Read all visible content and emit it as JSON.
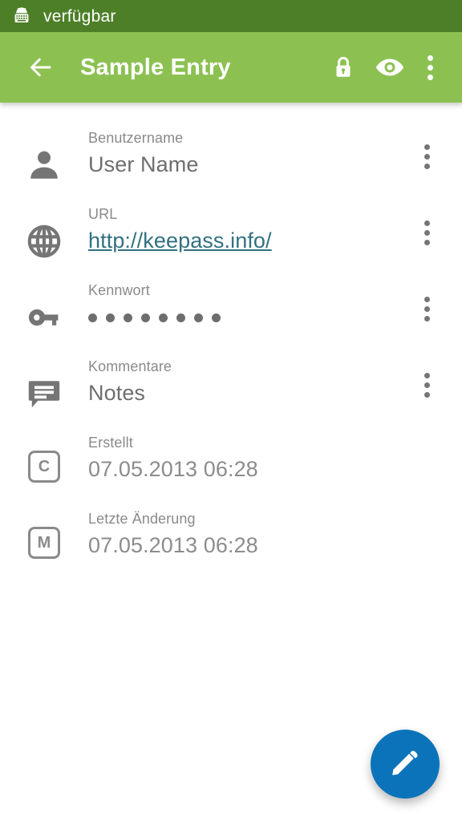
{
  "status_bar": {
    "icon": "android-keyboard-icon",
    "text": "verfügbar",
    "background": "#4c7f27",
    "text_color": "#ffffff"
  },
  "toolbar": {
    "back_icon": "arrow-back-icon",
    "title": "Sample Entry",
    "background": "#8cc152",
    "actions": [
      {
        "icon": "lock-icon",
        "name": "lock-database-button"
      },
      {
        "icon": "eye-icon",
        "name": "toggle-password-visibility-button"
      }
    ],
    "overflow_icon": "overflow-menu-icon"
  },
  "fields": [
    {
      "icon": "person-icon",
      "label": "Benutzername",
      "value": "User Name",
      "value_type": "text",
      "has_overflow": true
    },
    {
      "icon": "globe-icon",
      "label": "URL",
      "value": "http://keepass.info/",
      "value_type": "link",
      "has_overflow": true
    },
    {
      "icon": "key-icon",
      "label": "Kennwort",
      "value": "••••••••",
      "value_type": "masked",
      "dot_count": 8,
      "has_overflow": true
    },
    {
      "icon": "comment-icon",
      "label": "Kommentare",
      "value": "Notes",
      "value_type": "text",
      "has_overflow": true
    },
    {
      "icon": "created-badge-icon",
      "badge_letter": "C",
      "label": "Erstellt",
      "value": "07.05.2013 06:28",
      "value_type": "dim",
      "has_overflow": false
    },
    {
      "icon": "modified-badge-icon",
      "badge_letter": "M",
      "label": "Letzte Änderung",
      "value": "07.05.2013 06:28",
      "value_type": "dim",
      "has_overflow": false
    }
  ],
  "fab": {
    "icon": "edit-pencil-icon",
    "name": "edit-entry-fab",
    "color": "#0b73ba"
  },
  "colors": {
    "status_bar": "#4c7f27",
    "toolbar": "#8cc152",
    "background": "#ffffff",
    "label_text": "#8a8a8a",
    "value_text": "#6e6e6e",
    "link_text": "#31717f",
    "fab": "#0b73ba"
  }
}
